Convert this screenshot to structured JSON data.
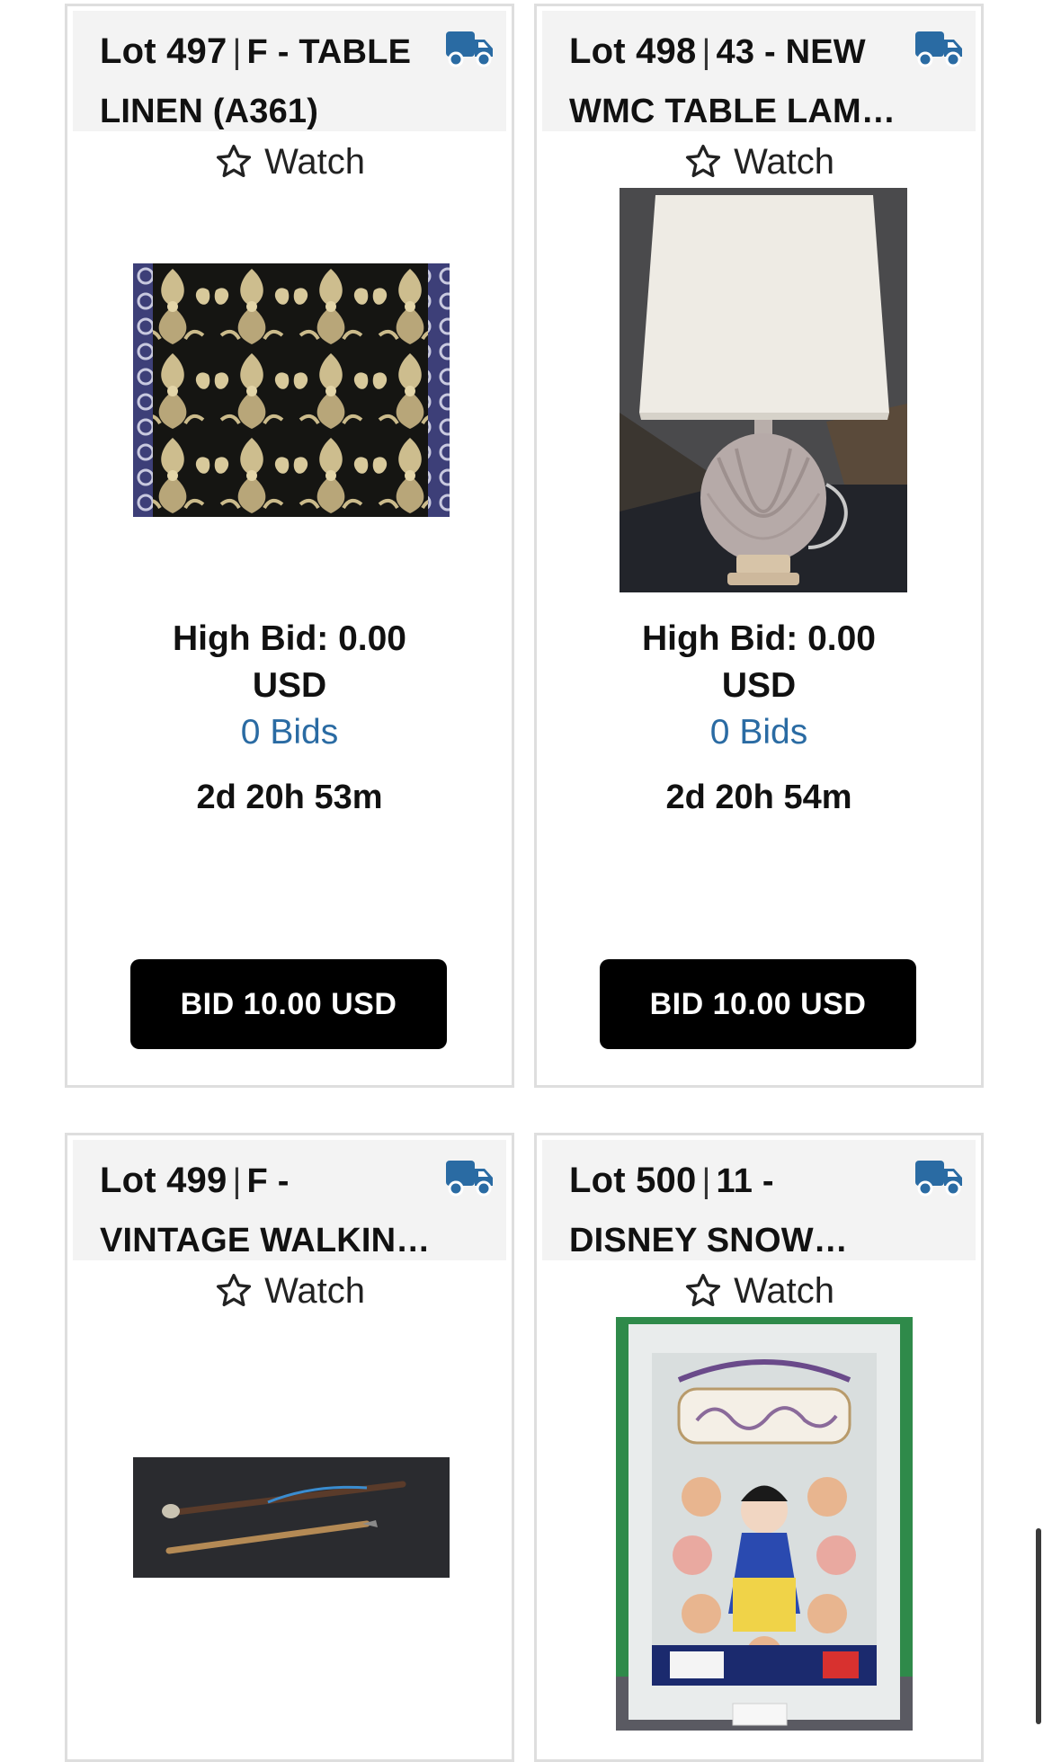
{
  "colors": {
    "accent": "#2a6ba3",
    "button_bg": "#000000",
    "card_border": "#dedede",
    "header_bg": "#f3f3f3"
  },
  "lots": [
    {
      "lot_label": "Lot 497",
      "sep": "|",
      "title_line1": "F - TABLE",
      "title_line2": "LINEN (A361)",
      "watch_label": "Watch",
      "high_bid": "High Bid: 0.00",
      "currency": "USD",
      "bids": "0 Bids",
      "time_left": "2d 20h 53m",
      "bid_button": "BID 10.00 USD",
      "icon": "shipping-truck-icon"
    },
    {
      "lot_label": "Lot 498",
      "sep": "|",
      "title_line1": "43 - NEW",
      "title_line2": "WMC TABLE LAM…",
      "watch_label": "Watch",
      "high_bid": "High Bid: 0.00",
      "currency": "USD",
      "bids": "0 Bids",
      "time_left": "2d 20h 54m",
      "bid_button": "BID 10.00 USD",
      "icon": "shipping-truck-icon"
    },
    {
      "lot_label": "Lot 499",
      "sep": "|",
      "title_line1": "F -",
      "title_line2": "VINTAGE WALKIN…",
      "watch_label": "Watch",
      "icon": "shipping-truck-icon"
    },
    {
      "lot_label": "Lot 500",
      "sep": "|",
      "title_line1": "11 -",
      "title_line2": "DISNEY SNOW…",
      "watch_label": "Watch",
      "icon": "shipping-truck-icon"
    }
  ]
}
